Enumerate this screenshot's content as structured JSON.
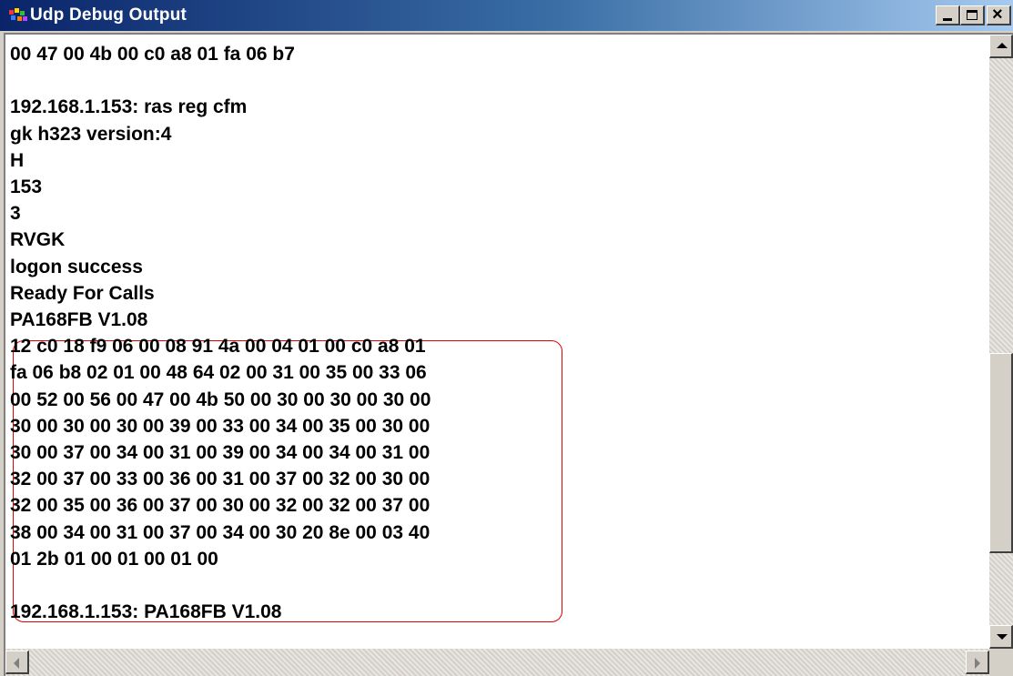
{
  "window": {
    "title": "Udp Debug Output",
    "icon": "app-icon",
    "controls": {
      "minimize": "minimize-icon",
      "maximize": "maximize-icon",
      "close": "close-icon"
    }
  },
  "output": {
    "lines": [
      "00 47 00 4b 00 c0 a8 01 fa 06 b7",
      "",
      "192.168.1.153: ras reg cfm",
      "gk h323 version:4",
      "H",
      "153",
      "3",
      "RVGK",
      "logon success",
      "Ready For Calls",
      "PA168FB V1.08",
      "12 c0 18 f9 06 00 08 91 4a 00 04 01 00 c0 a8 01",
      "fa 06 b8 02 01 00 48 64 02 00 31 00 35 00 33 06",
      "00 52 00 56 00 47 00 4b 50 00 30 00 30 00 30 00",
      "30 00 30 00 30 00 39 00 33 00 34 00 35 00 30 00",
      "30 00 37 00 34 00 31 00 39 00 34 00 34 00 31 00",
      "32 00 37 00 33 00 36 00 31 00 37 00 32 00 30 00",
      "32 00 35 00 36 00 37 00 30 00 32 00 32 00 37 00",
      "38 00 34 00 31 00 37 00 34 00 30 20 8e 00 03 40",
      "01 2b 01 00 01 00 01 00",
      "",
      "192.168.1.153: PA168FB V1.08"
    ],
    "highlight_color": "#e00000"
  },
  "colors": {
    "titlebar_start": "#0a246a",
    "titlebar_end": "#a6caf0",
    "window_face": "#d4d0c8",
    "text": "#000000"
  }
}
